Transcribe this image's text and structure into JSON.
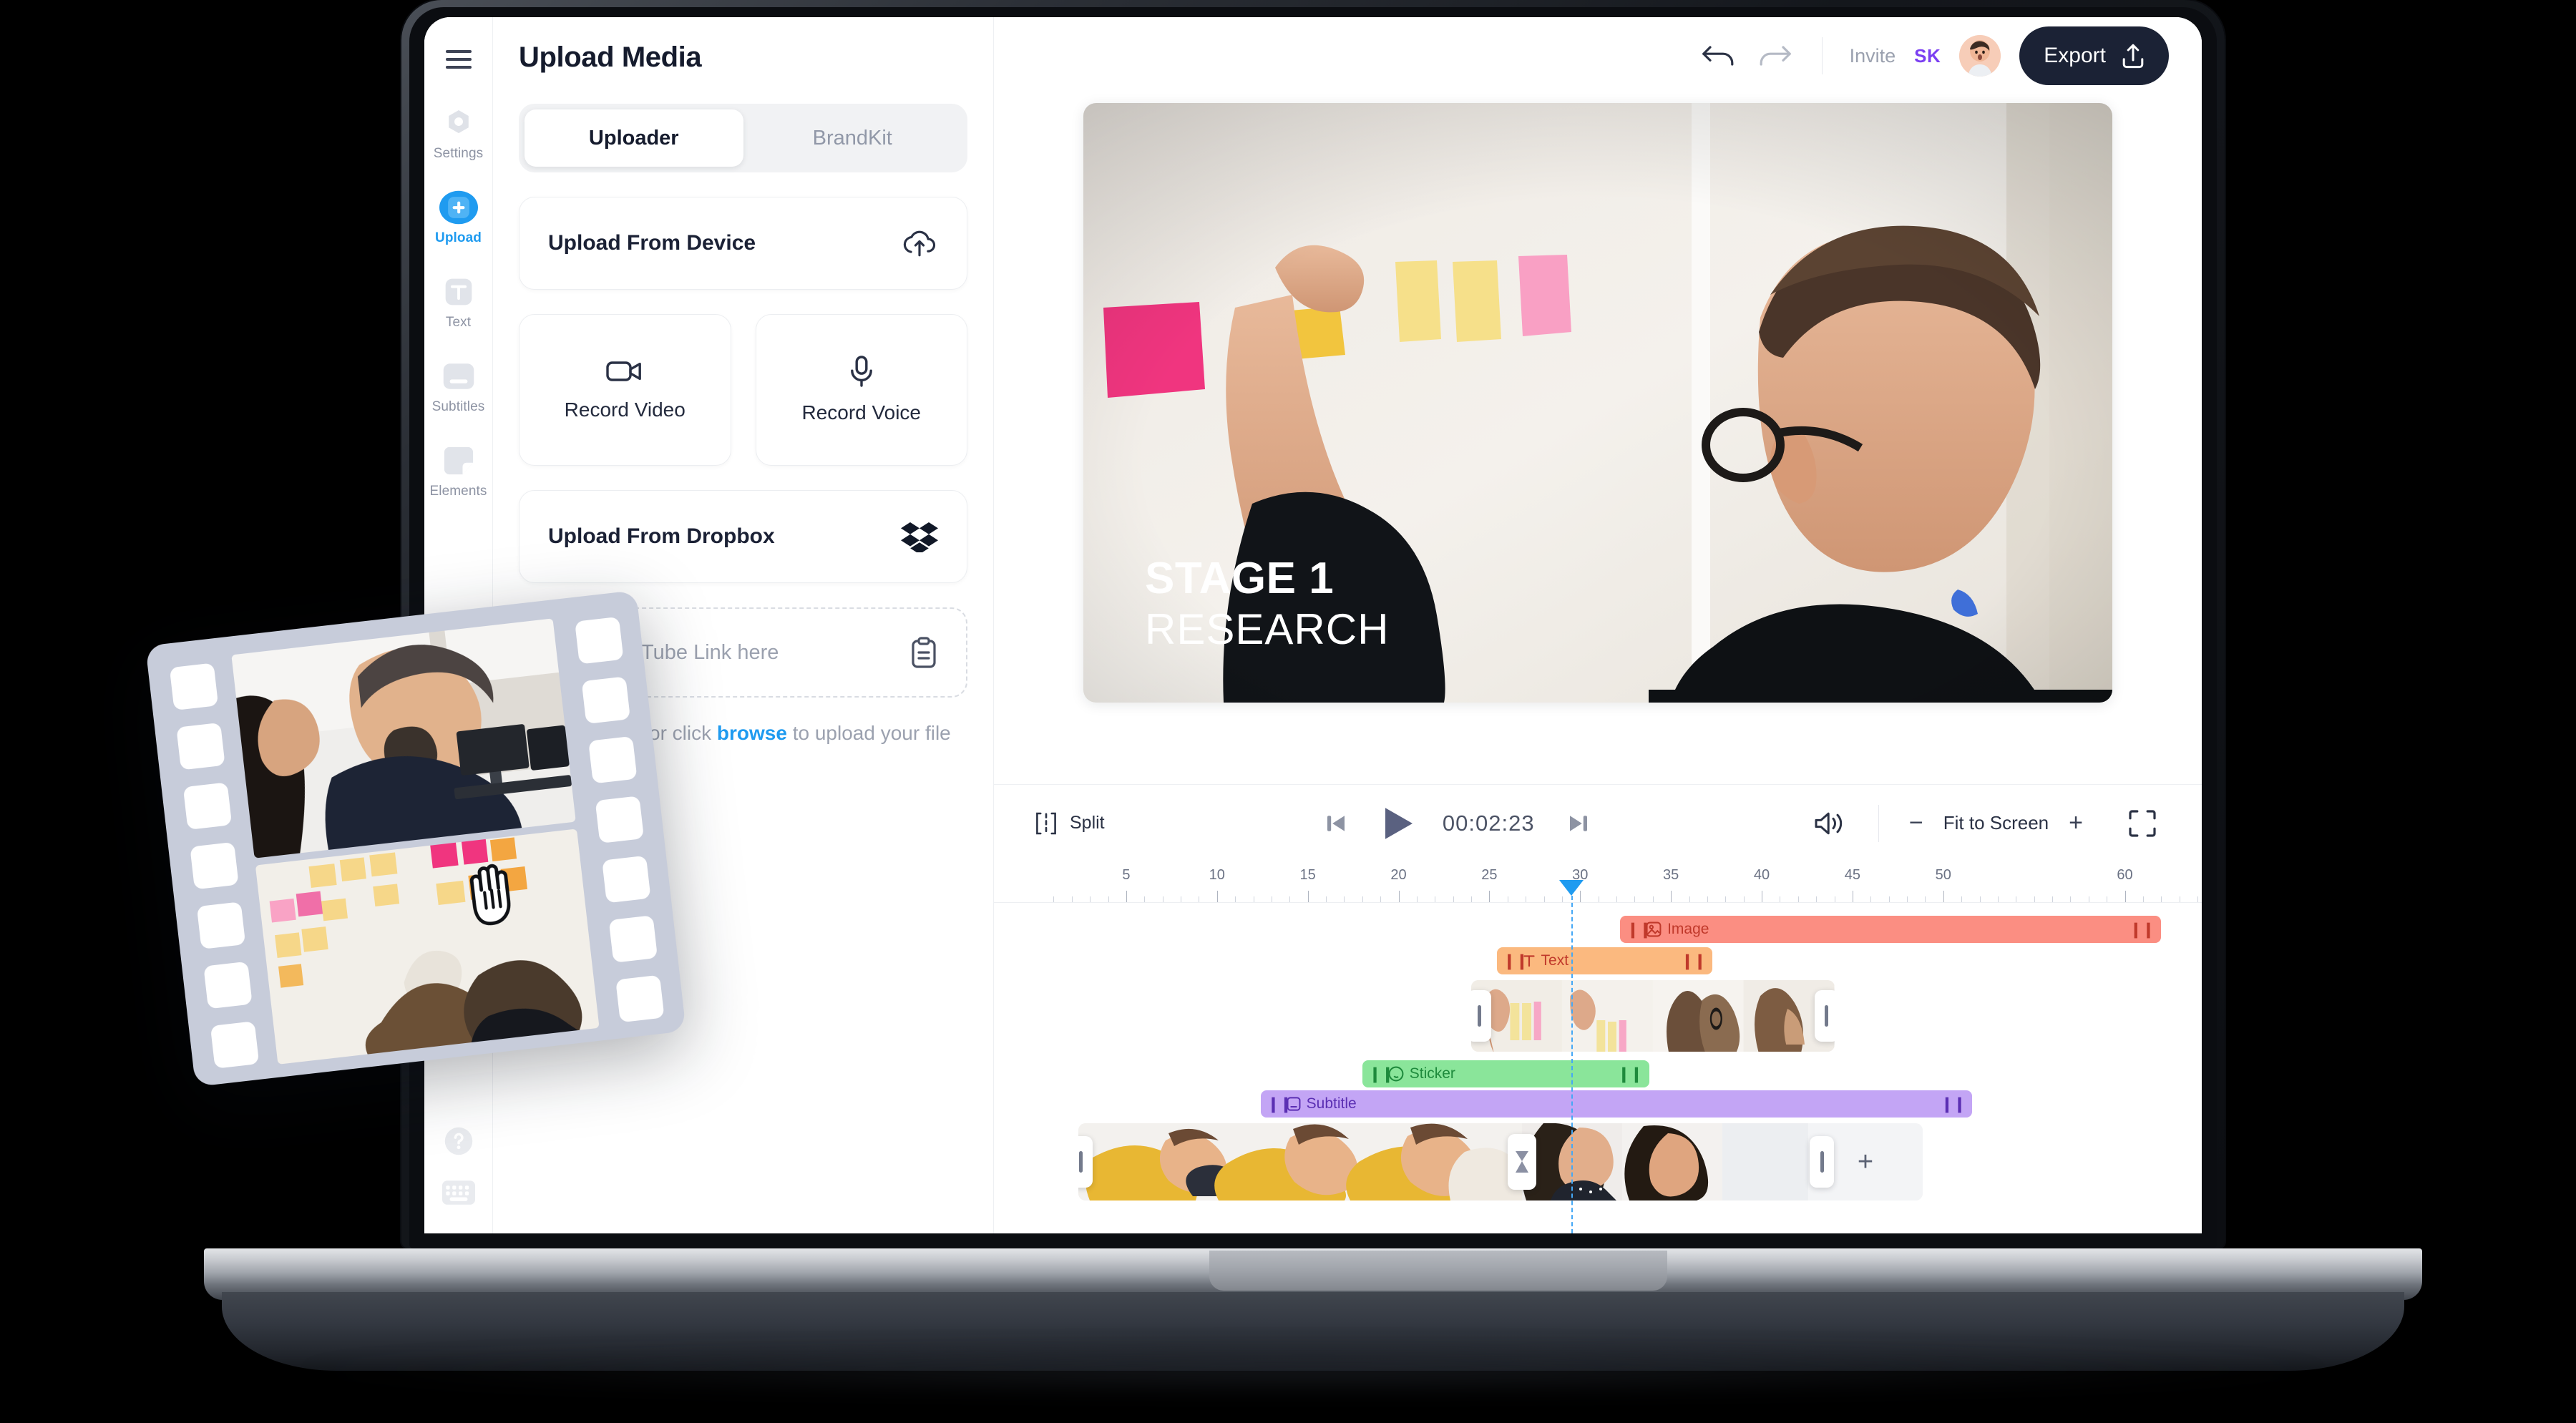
{
  "app": {
    "panel_title": "Upload Media",
    "tabs": [
      {
        "label": "Uploader",
        "active": true
      },
      {
        "label": "BrandKit",
        "active": false
      }
    ],
    "upload_options": {
      "upload_from_device": "Upload From Device",
      "record_video": "Record Video",
      "record_voice": "Record Voice",
      "upload_from_dropbox": "Upload From Dropbox",
      "youtube_placeholder": "Insert YouTube Link here",
      "drop_hint_before": "Drag & drop or click ",
      "drop_hint_link": "browse",
      "drop_hint_after": " to upload your file"
    },
    "rail": {
      "items": [
        {
          "label": "Settings",
          "icon": "settings-icon",
          "active": false
        },
        {
          "label": "Upload",
          "icon": "plus-icon",
          "active": true
        },
        {
          "label": "Text",
          "icon": "text-icon",
          "active": false
        },
        {
          "label": "Subtitles",
          "icon": "subtitles-icon",
          "active": false
        },
        {
          "label": "Elements",
          "icon": "elements-icon",
          "active": false
        }
      ],
      "bottom": [
        {
          "icon": "help-icon"
        },
        {
          "icon": "keyboard-icon"
        }
      ]
    },
    "topbar": {
      "undo_icon": "undo-icon",
      "redo_icon": "redo-icon",
      "invite_label": "Invite",
      "user_initials": "SK",
      "export_label": "Export",
      "export_icon": "share-upload-icon",
      "export_bg": "#1b2235",
      "initials_color": "#7b3ff2"
    },
    "preview": {
      "title_line1": "STAGE 1",
      "title_line2": "RESEARCH"
    },
    "player": {
      "split_label": "Split",
      "skip_start_icon": "skip-start-icon",
      "play_icon": "play-icon",
      "timecode": "00:02:23",
      "skip_end_icon": "skip-end-icon",
      "volume_icon": "volume-icon",
      "zoom_out": "−",
      "zoom_label": "Fit to Screen",
      "zoom_in": "+",
      "fullscreen_icon": "fullscreen-icon"
    },
    "timeline": {
      "accent": "#1f9bf0",
      "ruler_labels": [
        5,
        10,
        15,
        20,
        25,
        30,
        35,
        40,
        45,
        50,
        60
      ],
      "playhead_seconds": 29.5,
      "clips": [
        {
          "name": "Image",
          "type": "image",
          "color": "#fb8e82",
          "text_color": "#c0392b",
          "start": 32.2,
          "end": 62.0
        },
        {
          "name": "Text",
          "type": "text",
          "color": "#fbb97f",
          "text_color": "#c0392b",
          "start": 25.4,
          "end": 37.3
        },
        {
          "name": "Sticker",
          "type": "sticker",
          "color": "#8ae59a",
          "text_color": "#1e8a3c",
          "start": 18.0,
          "end": 33.8
        },
        {
          "name": "Subtitle",
          "type": "subtitle",
          "color": "#c3a5f5",
          "text_color": "#5b2fb3",
          "start": 12.4,
          "end": 51.6
        }
      ]
    }
  }
}
